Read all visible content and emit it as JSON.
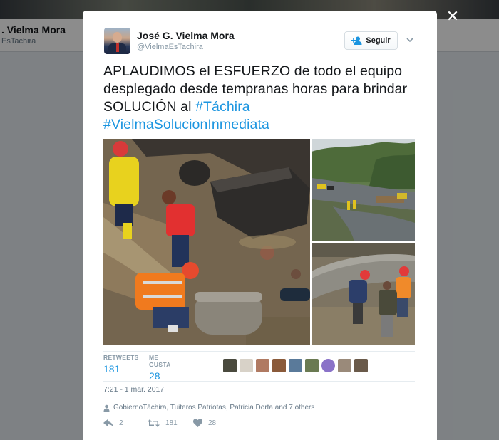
{
  "background": {
    "name": ". Vielma Mora",
    "handle": "EsTachira"
  },
  "tweet": {
    "author_name": "José G. Vielma Mora",
    "author_handle": "@VielmaEsTachira",
    "follow_label": "Seguir",
    "text_plain": "APLAUDIMOS el ESFUERZO de todo el equipo desplegado desde tempranas horas para brindar SOLUCIÓN al ",
    "hashtag_1": "#Táchira",
    "hashtag_2": "#VielmaSolucionInmediata",
    "stats": {
      "retweets_label": "RETWEETS",
      "retweets_value": "181",
      "likes_label": "ME GUSTA",
      "likes_value": "28"
    },
    "liker_avatar_colors": [
      "#4a4a3e",
      "#d8d2c8",
      "#b07a62",
      "#8a5a3a",
      "#5a7a9a",
      "#6a7a52",
      "#8a72c8",
      "#9a8a7a",
      "#6a5a4a"
    ],
    "timestamp": "7:21 - 1 mar. 2017",
    "retweeted_by": "GobiernoTáchira, Tuiteros Patriotas, Patricia Dorta and 7 others",
    "actions": {
      "reply_count": "2",
      "retweet_count": "181",
      "like_count": "28"
    }
  },
  "colors": {
    "link": "#1b95e0",
    "muted": "#8899a6",
    "text": "#14171a"
  }
}
